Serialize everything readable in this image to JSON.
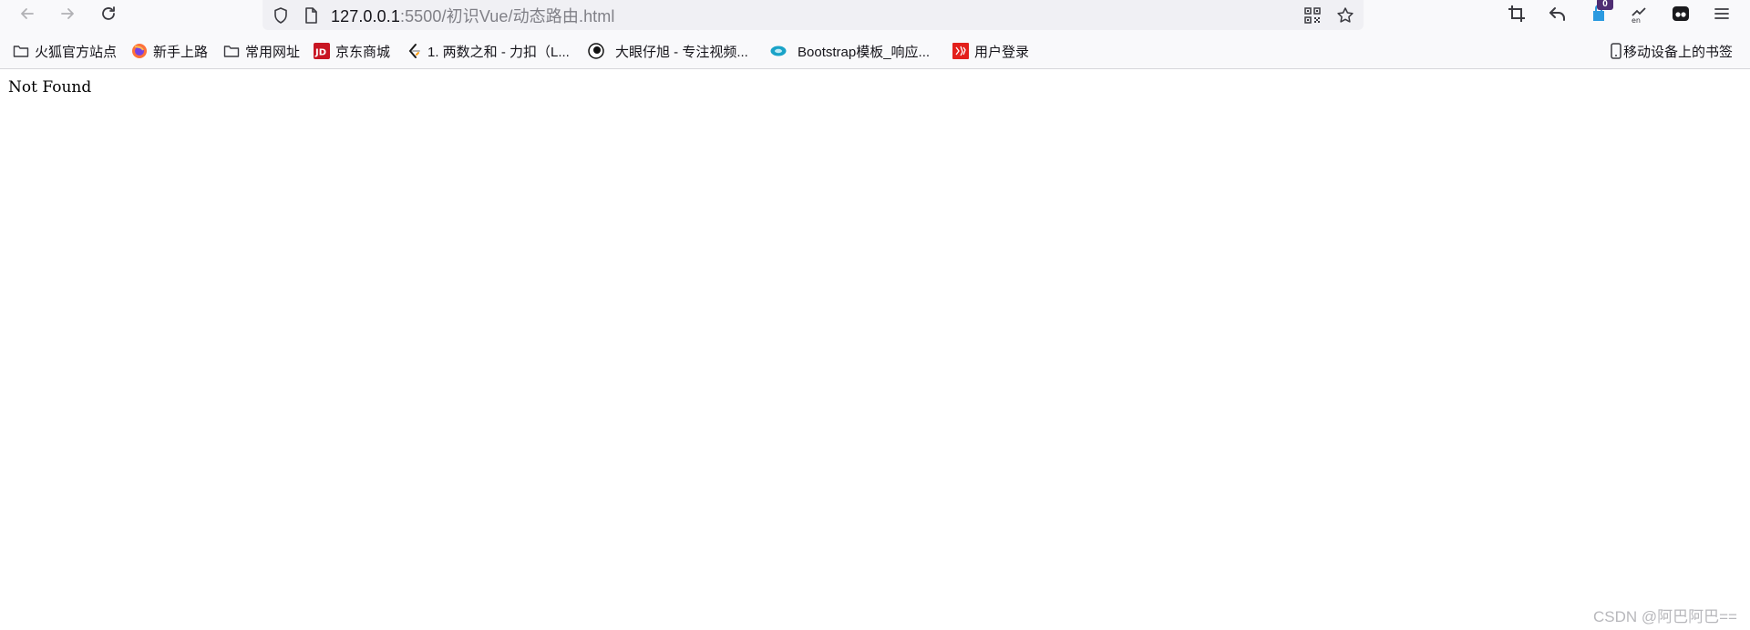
{
  "browser": {
    "url": {
      "host": "127.0.0.1",
      "rest": ":5500/初识Vue/动态路由.html"
    },
    "badge_count": "0",
    "icons": {
      "back": "back-arrow-icon",
      "forward": "forward-arrow-icon",
      "reload": "reload-icon",
      "shield": "shield-icon",
      "page": "page-icon",
      "qr": "qr-code-icon",
      "star": "star-icon",
      "crop": "crop-icon",
      "undo": "undo-icon",
      "extension": "extension-icon",
      "translate": "translate-icon",
      "mask": "mask-icon",
      "menu": "menu-icon"
    },
    "colors": {
      "chrome_bg": "#f9f9fb",
      "urlbar_bg": "#f0f0f4",
      "badge_bg": "#4f2d73"
    }
  },
  "bookmarks": {
    "items": [
      {
        "label": "火狐官方站点",
        "icon": "folder-icon"
      },
      {
        "label": "新手上路",
        "icon": "firefox-icon"
      },
      {
        "label": "常用网址",
        "icon": "folder-icon"
      },
      {
        "label": "京东商城",
        "icon": "jd-icon"
      },
      {
        "label": "1. 两数之和 - 力扣（L...",
        "icon": "leetcode-icon"
      },
      {
        "label": "大眼仔旭 - 专注视频...",
        "icon": "eye-icon"
      },
      {
        "label": "Bootstrap模板_响应...",
        "icon": "bootstrap-icon"
      },
      {
        "label": "用户登录",
        "icon": "login-icon"
      }
    ],
    "mobile": {
      "label": "移动设备上的书签",
      "icon": "mobile-icon"
    }
  },
  "page": {
    "message": "Not Found"
  },
  "watermark": {
    "text": "CSDN @阿巴阿巴=="
  }
}
